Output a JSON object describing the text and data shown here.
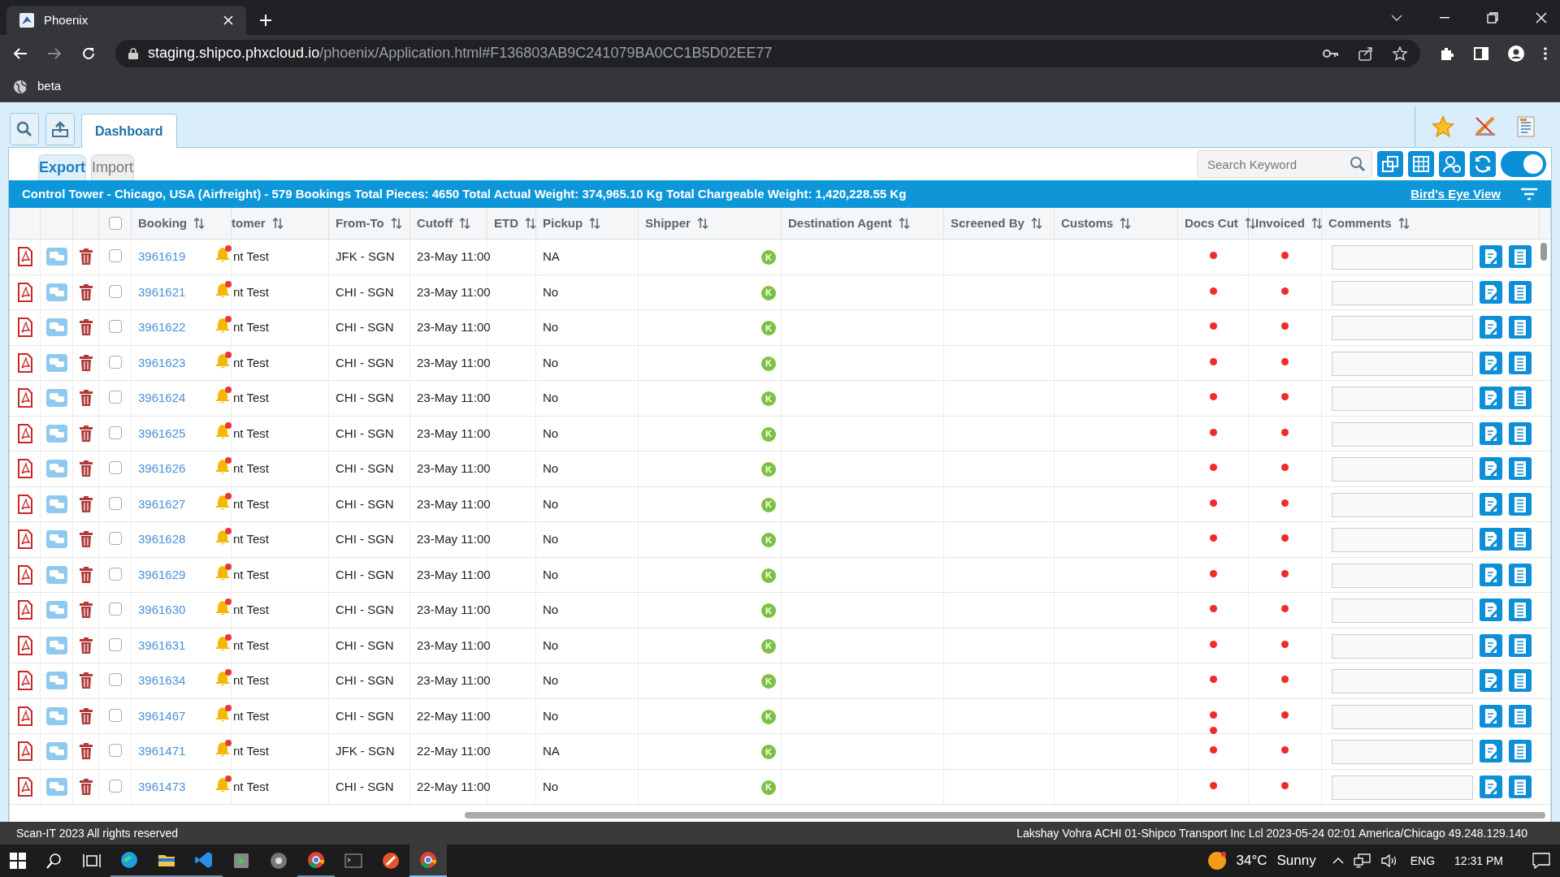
{
  "browser": {
    "tab_title": "Phoenix",
    "url_host": "staging.shipco.phxcloud.io",
    "url_path": "/phoenix/Application.html#F136803AB9C241079BA0CC1B5D02EE77",
    "bookmark": "beta"
  },
  "app_tabs": [
    {
      "label": "Dashboard",
      "selected": true
    }
  ],
  "sub_tabs": [
    {
      "label": "Export",
      "selected": true
    },
    {
      "label": "Import",
      "selected": false
    }
  ],
  "search": {
    "placeholder": "Search Keyword"
  },
  "toggle": {
    "on": true
  },
  "banner": {
    "text": "Control Tower - Chicago, USA (Airfreight) - 579 Bookings Total Pieces: 4650 Total Actual Weight: 374,965.10 Kg Total Chargeable Weight: 1,420,228.55 Kg",
    "link": "Bird's Eye View"
  },
  "select_all": {
    "checked": false
  },
  "columns": [
    "Booking",
    "tomer",
    "From-To",
    "Cutoff",
    "ETD",
    "Pickup",
    "Shipper",
    "Destination Agent",
    "Screened By",
    "Customs",
    "Docs Cut",
    "Invoiced",
    "Comments"
  ],
  "rows": [
    {
      "booking": "3961619",
      "customer": "nt Test",
      "from_to": "JFK - SGN",
      "cutoff": "23-May 11:00",
      "pickup": "NA",
      "shipper_badge": "K",
      "checked": false,
      "docs_cut": [
        {
          "color": "#ef2b2b"
        }
      ],
      "invoiced": [
        {
          "color": "#ef2b2b"
        }
      ]
    },
    {
      "booking": "3961621",
      "customer": "nt Test",
      "from_to": "CHI - SGN",
      "cutoff": "23-May 11:00",
      "pickup": "No",
      "shipper_badge": "K",
      "checked": false,
      "docs_cut": [
        {
          "color": "#ef2b2b"
        }
      ],
      "invoiced": [
        {
          "color": "#ef2b2b"
        }
      ]
    },
    {
      "booking": "3961622",
      "customer": "nt Test",
      "from_to": "CHI - SGN",
      "cutoff": "23-May 11:00",
      "pickup": "No",
      "shipper_badge": "K",
      "checked": false,
      "docs_cut": [
        {
          "color": "#ef2b2b"
        }
      ],
      "invoiced": [
        {
          "color": "#ef2b2b"
        }
      ]
    },
    {
      "booking": "3961623",
      "customer": "nt Test",
      "from_to": "CHI - SGN",
      "cutoff": "23-May 11:00",
      "pickup": "No",
      "shipper_badge": "K",
      "checked": false,
      "docs_cut": [
        {
          "color": "#ef2b2b"
        }
      ],
      "invoiced": [
        {
          "color": "#ef2b2b"
        }
      ]
    },
    {
      "booking": "3961624",
      "customer": "nt Test",
      "from_to": "CHI - SGN",
      "cutoff": "23-May 11:00",
      "pickup": "No",
      "shipper_badge": "K",
      "checked": false,
      "docs_cut": [
        {
          "color": "#ef2b2b"
        }
      ],
      "invoiced": [
        {
          "color": "#ef2b2b"
        }
      ]
    },
    {
      "booking": "3961625",
      "customer": "nt Test",
      "from_to": "CHI - SGN",
      "cutoff": "23-May 11:00",
      "pickup": "No",
      "shipper_badge": "K",
      "checked": false,
      "docs_cut": [
        {
          "color": "#ef2b2b"
        }
      ],
      "invoiced": [
        {
          "color": "#ef2b2b"
        }
      ]
    },
    {
      "booking": "3961626",
      "customer": "nt Test",
      "from_to": "CHI - SGN",
      "cutoff": "23-May 11:00",
      "pickup": "No",
      "shipper_badge": "K",
      "checked": false,
      "docs_cut": [
        {
          "color": "#ef2b2b"
        }
      ],
      "invoiced": [
        {
          "color": "#ef2b2b"
        }
      ]
    },
    {
      "booking": "3961627",
      "customer": "nt Test",
      "from_to": "CHI - SGN",
      "cutoff": "23-May 11:00",
      "pickup": "No",
      "shipper_badge": "K",
      "checked": false,
      "docs_cut": [
        {
          "color": "#ef2b2b"
        }
      ],
      "invoiced": [
        {
          "color": "#ef2b2b"
        }
      ]
    },
    {
      "booking": "3961628",
      "customer": "nt Test",
      "from_to": "CHI - SGN",
      "cutoff": "23-May 11:00",
      "pickup": "No",
      "shipper_badge": "K",
      "checked": false,
      "docs_cut": [
        {
          "color": "#ef2b2b"
        }
      ],
      "invoiced": [
        {
          "color": "#ef2b2b"
        }
      ]
    },
    {
      "booking": "3961629",
      "customer": "nt Test",
      "from_to": "CHI - SGN",
      "cutoff": "23-May 11:00",
      "pickup": "No",
      "shipper_badge": "K",
      "checked": false,
      "docs_cut": [
        {
          "color": "#ef2b2b"
        }
      ],
      "invoiced": [
        {
          "color": "#ef2b2b"
        }
      ]
    },
    {
      "booking": "3961630",
      "customer": "nt Test",
      "from_to": "CHI - SGN",
      "cutoff": "23-May 11:00",
      "pickup": "No",
      "shipper_badge": "K",
      "checked": false,
      "docs_cut": [
        {
          "color": "#ef2b2b"
        }
      ],
      "invoiced": [
        {
          "color": "#ef2b2b"
        }
      ]
    },
    {
      "booking": "3961631",
      "customer": "nt Test",
      "from_to": "CHI - SGN",
      "cutoff": "23-May 11:00",
      "pickup": "No",
      "shipper_badge": "K",
      "checked": false,
      "docs_cut": [
        {
          "color": "#ef2b2b"
        }
      ],
      "invoiced": [
        {
          "color": "#ef2b2b"
        }
      ]
    },
    {
      "booking": "3961634",
      "customer": "nt Test",
      "from_to": "CHI - SGN",
      "cutoff": "23-May 11:00",
      "pickup": "No",
      "shipper_badge": "K",
      "checked": false,
      "docs_cut": [
        {
          "color": "#ef2b2b"
        }
      ],
      "invoiced": [
        {
          "color": "#ef2b2b"
        }
      ]
    },
    {
      "booking": "3961467",
      "customer": "nt Test",
      "from_to": "CHI - SGN",
      "cutoff": "22-May 11:00",
      "pickup": "No",
      "shipper_badge": "K",
      "checked": false,
      "docs_cut": [
        {
          "color": "#ef2b2b"
        },
        {
          "color": "#ef2b2b"
        }
      ],
      "invoiced": [
        {
          "color": "#ef2b2b"
        }
      ]
    },
    {
      "booking": "3961471",
      "customer": "nt Test",
      "from_to": "JFK - SGN",
      "cutoff": "22-May 11:00",
      "pickup": "NA",
      "shipper_badge": "K",
      "checked": false,
      "docs_cut": [
        {
          "color": "#ef2b2b"
        }
      ],
      "invoiced": [
        {
          "color": "#ef2b2b"
        }
      ]
    },
    {
      "booking": "3961473",
      "customer": "nt Test",
      "from_to": "CHI - SGN",
      "cutoff": "22-May 11:00",
      "pickup": "No",
      "shipper_badge": "K",
      "checked": false,
      "docs_cut": [
        {
          "color": "#ef2b2b"
        }
      ],
      "invoiced": [
        {
          "color": "#ef2b2b"
        }
      ]
    }
  ],
  "footer": {
    "left": "Scan-IT 2023 All rights reserved",
    "right": "Lakshay Vohra ACHI 01-Shipco Transport Inc Lcl 2023-05-24 02:01 America/Chicago 49.248.129.140"
  },
  "taskbar": {
    "temperature": "34°C",
    "weather": "Sunny",
    "language": "ENG",
    "time": "12:31 PM"
  }
}
